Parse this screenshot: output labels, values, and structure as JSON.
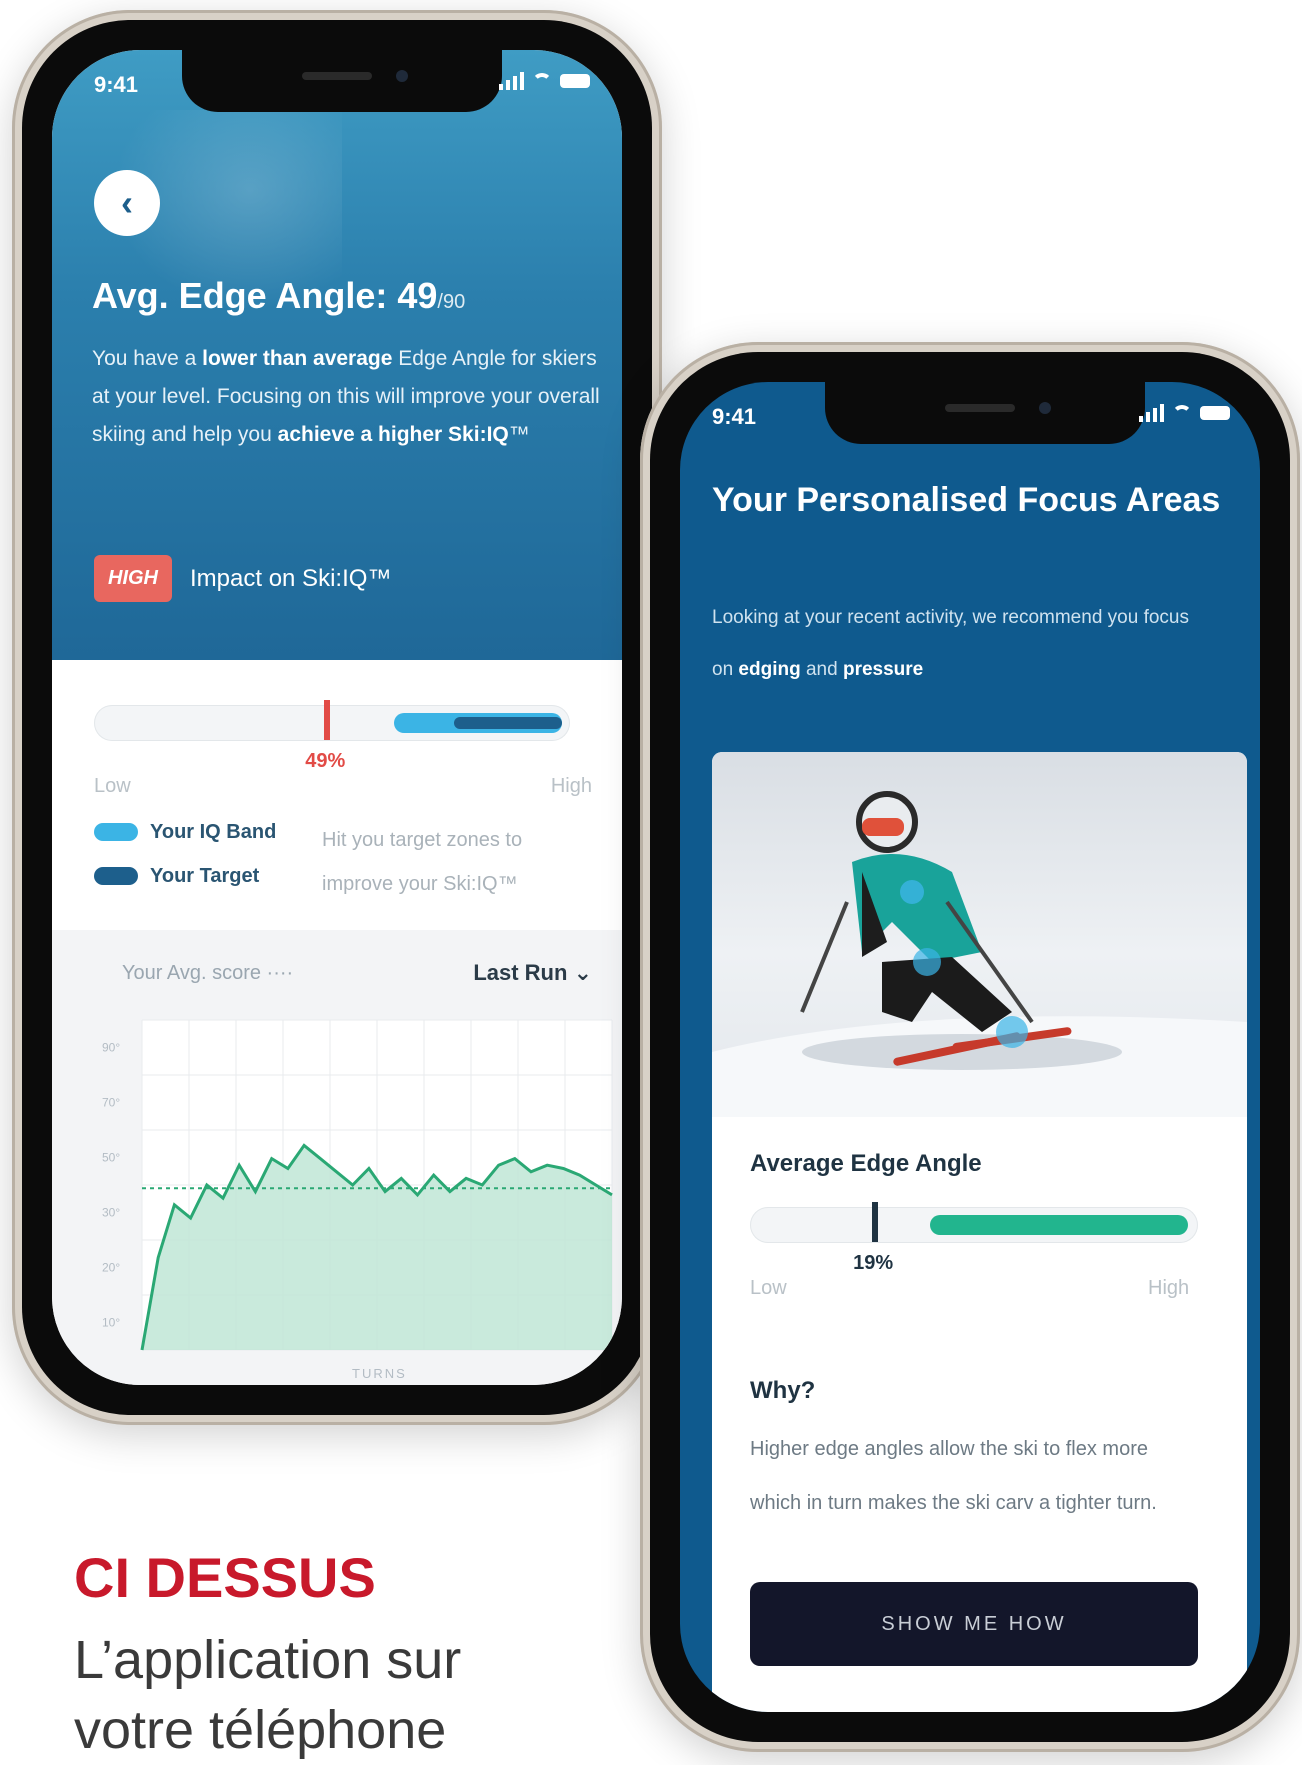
{
  "screen1": {
    "status_time": "9:41",
    "title_main": "Avg. Edge Angle: 49",
    "title_suffix": "/90",
    "desc_1": "You have a ",
    "desc_bold_1": "lower than average",
    "desc_2": " Edge Angle for skiers at your level. Focusing on this will improve your overall skiing and help you ",
    "desc_bold_2": "achieve a higher Ski:IQ",
    "desc_3": "™",
    "impact_badge": "HIGH",
    "impact_text": "Impact on Ski:IQ™",
    "marker_percent": "49%",
    "marker_value": 49,
    "low_label": "Low",
    "high_label": "High",
    "legend_iq_band": "Your IQ Band",
    "legend_target": "Your Target",
    "legend_note": "Hit you target zones to improve your Ski:IQ™",
    "chart_header": "Your Avg. score ····",
    "chart_filter": "Last Run",
    "x_axis_label": "TURNS",
    "colors": {
      "accent_red": "#e24b46",
      "iq_band": "#3bb4e5",
      "target": "#1d5f8c",
      "hero_top": "#3f9cc4",
      "hero_bottom": "#1f6898",
      "line": "#2aa874"
    }
  },
  "chart_data": {
    "type": "area",
    "title": "",
    "xlabel": "TURNS",
    "ylabel": "",
    "y_ticks": [
      "90°",
      "70°",
      "50°",
      "30°",
      "20°",
      "10°"
    ],
    "ylim": [
      0,
      100
    ],
    "average_line": 49,
    "grid": true,
    "series": [
      {
        "values": [
          0,
          28,
          44,
          40,
          50,
          46,
          56,
          48,
          58,
          55,
          62,
          58,
          54,
          50,
          55,
          48,
          52,
          47,
          53,
          48,
          52,
          50,
          56,
          58,
          54,
          56,
          55,
          53,
          50,
          47
        ]
      }
    ]
  },
  "screen2": {
    "status_time": "9:41",
    "title": "Your Personalised Focus Areas",
    "desc_1": "Looking at your recent activity, we recommend you focus on ",
    "desc_bold_1": "edging",
    "desc_2": " and ",
    "desc_bold_2": "pressure",
    "card_title": "Average Edge Angle",
    "marker_percent": "19%",
    "marker_value": 19,
    "low_label": "Low",
    "high_label": "High",
    "why_title": "Why?",
    "why_desc": "Higher edge angles allow the ski to flex more which in turn makes the ski carv a tighter turn.",
    "button_label": "SHOW ME HOW",
    "colors": {
      "band": "#22b58e",
      "screen_bg": "#0f5a8e",
      "button_bg": "#13162a"
    }
  },
  "caption": {
    "title": "CI DESSUS",
    "text": "L’application sur votre téléphone"
  }
}
